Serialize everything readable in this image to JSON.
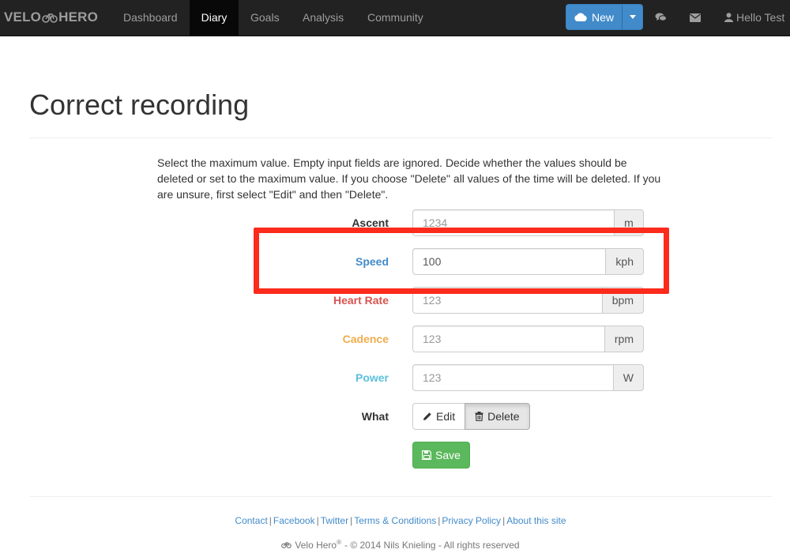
{
  "navbar": {
    "brand_left": "VELO",
    "brand_right": "HERO",
    "items": [
      {
        "label": "Dashboard",
        "active": false
      },
      {
        "label": "Diary",
        "active": true
      },
      {
        "label": "Goals",
        "active": false
      },
      {
        "label": "Analysis",
        "active": false
      },
      {
        "label": "Community",
        "active": false
      }
    ],
    "new_button": "New",
    "user_label": "Hello Test"
  },
  "page": {
    "title": "Correct recording",
    "intro": "Select the maximum value. Empty input fields are ignored. Decide whether the values should be deleted or set to the maximum value. If you choose \"Delete\" all values of the time will be deleted. If you are unsure, first select \"Edit\" and then \"Delete\"."
  },
  "form": {
    "fields": [
      {
        "label": "Ascent",
        "value": "",
        "placeholder": "1234",
        "unit": "m",
        "color": "#333333"
      },
      {
        "label": "Speed",
        "value": "100",
        "placeholder": "",
        "unit": "kph",
        "color": "#428bca"
      },
      {
        "label": "Heart Rate",
        "value": "",
        "placeholder": "123",
        "unit": "bpm",
        "color": "#d9534f"
      },
      {
        "label": "Cadence",
        "value": "",
        "placeholder": "123",
        "unit": "rpm",
        "color": "#f0ad4e"
      },
      {
        "label": "Power",
        "value": "",
        "placeholder": "123",
        "unit": "W",
        "color": "#5bc0de"
      }
    ],
    "what_label": "What",
    "edit_label": "Edit",
    "delete_label": "Delete",
    "save_label": "Save"
  },
  "footer": {
    "links": [
      "Contact",
      "Facebook",
      "Twitter",
      "Terms & Conditions",
      "Privacy Policy",
      "About this site"
    ],
    "brand": "Velo Hero",
    "copyright": "- © 2014 Nils Knieling - All rights reserved"
  },
  "colors": {
    "navbar_bg": "#222222",
    "primary": "#428bca",
    "success": "#5cb85c",
    "highlight": "#fc2b1c"
  }
}
